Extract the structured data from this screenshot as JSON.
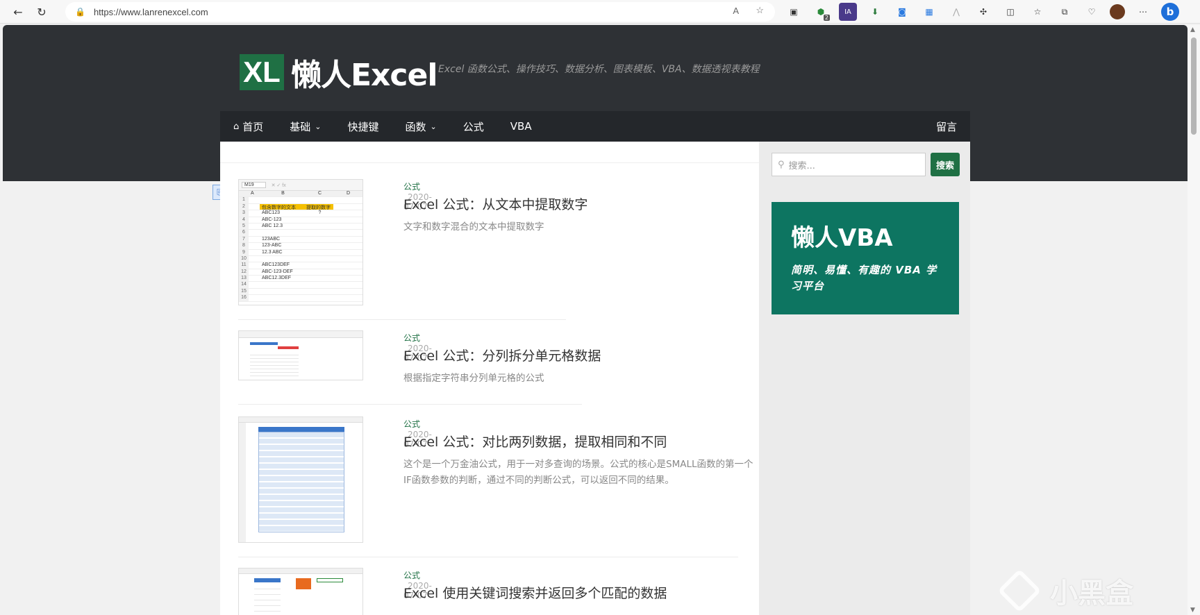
{
  "browser": {
    "url": "https://www.lanrenexcel.com",
    "ext_badge": "2"
  },
  "site": {
    "logo_mark": "XL",
    "logo_name": "懒人Excel",
    "tagline": "Excel 函数公式、操作技巧、数据分析、图表模板、VBA、数据透视表教程"
  },
  "nav": {
    "home": "首页",
    "basics": "基础",
    "shortcuts": "快捷键",
    "functions": "函数",
    "formulas": "公式",
    "vba": "VBA",
    "guestbook": "留言"
  },
  "posts": [
    {
      "category": "公式",
      "date": "2020-07-07",
      "title": "Excel 公式：从文本中提取数字",
      "excerpt": "文字和数字混合的文本中提取数字"
    },
    {
      "category": "公式",
      "date": "2020-07-07",
      "title": "Excel 公式：分列拆分单元格数据",
      "excerpt": "根据指定字符串分列单元格的公式"
    },
    {
      "category": "公式",
      "date": "2020-07-07",
      "title": "Excel 公式：对比两列数据，提取相同和不同",
      "excerpt": "这个是一个万金油公式，用于一对多查询的场景。公式的核心是SMALL函数的第一个IF函数参数的判断，通过不同的判断公式，可以返回不同的结果。"
    },
    {
      "category": "公式",
      "date": "2020-07-07",
      "title": "Excel 使用关键词搜索并返回多个匹配的数据",
      "excerpt": ""
    }
  ],
  "thumb1": {
    "name_box": "M19",
    "headers": [
      "A",
      "B",
      "C",
      "D"
    ],
    "header_b": "包含数字的文本",
    "header_c": "提取的数字",
    "c3": "?",
    "rows": [
      "ABC123",
      "ABC-123",
      "ABC 12.3",
      "",
      "123ABC",
      "123-ABC",
      "12.3 ABC",
      "",
      "ABC123DEF",
      "ABC-123-DEF",
      "ABC12.3DEF"
    ]
  },
  "sidebar": {
    "search_placeholder": "搜索...",
    "search_button": "搜索",
    "ad_title": "懒人VBA",
    "ad_subtitle": "简明、易懂、有趣的 VBA 学习平台"
  },
  "watermark": "小黑盒",
  "colors": {
    "brand_green": "#1f7044",
    "header_dark": "#2e3135",
    "ad_teal": "#0d7561"
  }
}
